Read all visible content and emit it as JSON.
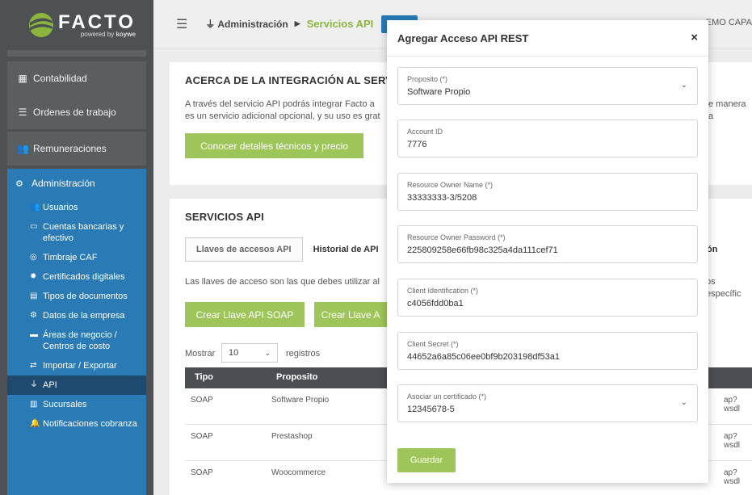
{
  "brand": {
    "name": "FACTO",
    "powered": "powered by",
    "company": "koywe"
  },
  "sidebar": {
    "items": [
      {
        "label": "Contabilidad",
        "icon": "calculator-icon"
      },
      {
        "label": "Ordenes de trabajo",
        "icon": "list-icon"
      },
      {
        "label": "Remuneraciones",
        "icon": "users-icon"
      }
    ],
    "admin": {
      "label": "Administración",
      "items": [
        {
          "label": "Usuarios",
          "icon": "users-icon"
        },
        {
          "label": "Cuentas bancarias y efectivo",
          "icon": "money-icon"
        },
        {
          "label": "Timbraje CAF",
          "icon": "stamp-icon"
        },
        {
          "label": "Certificados digitales",
          "icon": "certificate-icon"
        },
        {
          "label": "Tipos de documentos",
          "icon": "document-icon"
        },
        {
          "label": "Datos de la empresa",
          "icon": "gear-icon"
        },
        {
          "label": "Áreas de negocio / Centros de costo",
          "icon": "archive-icon"
        },
        {
          "label": "Importar / Exportar",
          "icon": "exchange-icon"
        },
        {
          "label": "API",
          "icon": "plug-icon"
        },
        {
          "label": "Sucursales",
          "icon": "building-icon"
        },
        {
          "label": "Notificaciones cobranza",
          "icon": "bell-icon"
        }
      ]
    }
  },
  "topbar": {
    "crumb_parent": "Administración",
    "crumb_current": "Servicios API",
    "badge": "",
    "user": "EMO CAPA"
  },
  "about": {
    "title": "ACERCA DE LA INTEGRACIÓN AL SERVIC",
    "line1": "A través del servicio API podrás integrar Facto a",
    "line1_right": "e manera a",
    "line2": "es un servicio adicional opcional, y su uso es grat",
    "button": "Conocer detalles técnicos y precio"
  },
  "services": {
    "title": "SERVICIOS API",
    "tabs": [
      "Llaves de accesos API",
      "Historial de API"
    ],
    "tab_right": "ón",
    "info": "Las llaves de acceso son las que debes utilizar al",
    "info_right": "os específic",
    "btn_soap": "Crear Llave API SOAP",
    "btn_rest": "Crear Llave A",
    "show_label": "Mostrar",
    "show_value": "10",
    "records_label": "registros",
    "columns": [
      "Tipo",
      "Proposito"
    ],
    "rows": [
      {
        "tipo": "SOAP",
        "proposito": "Software Propio",
        "url": "ap?wsdl"
      },
      {
        "tipo": "SOAP",
        "proposito": "Prestashop",
        "url": "ap?wsdl"
      },
      {
        "tipo": "SOAP",
        "proposito": "Woocommerce",
        "url": "ap?wsdl"
      }
    ]
  },
  "modal": {
    "title": "Agregar Acceso API REST",
    "close": "×",
    "fields": [
      {
        "label": "Proposito (*)",
        "value": "Software Propio",
        "select": true
      },
      {
        "label": "Account ID",
        "value": "7776"
      },
      {
        "label": "Resource Owner Name (*)",
        "value": "33333333-3/5208"
      },
      {
        "label": "Resource Owner Password (*)",
        "value": "225809258e66fb98c325a4da111cef71"
      },
      {
        "label": "Client Identification (*)",
        "value": "c4056fdd0ba1"
      },
      {
        "label": "Client Secret (*)",
        "value": "44652a6a85c06ee0bf9b203198df53a1"
      },
      {
        "label": "Asociar un certificado (*)",
        "value": "12345678-5",
        "select": true
      }
    ],
    "save": "Guardar"
  }
}
